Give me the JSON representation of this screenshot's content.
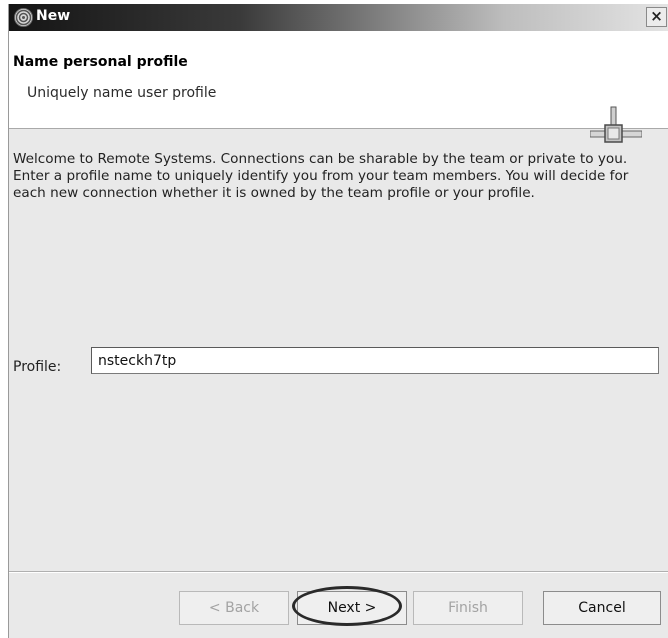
{
  "window": {
    "title": "New",
    "close_label": "×"
  },
  "header": {
    "title": "Name personal profile",
    "subtitle": "Uniquely name user profile"
  },
  "body": {
    "description": "Welcome to Remote Systems. Connections can be sharable by the team or private to you. Enter a profile name to uniquely identify you from your team members. You will decide for each new connection whether it is owned by the team profile or your profile."
  },
  "profile": {
    "label": "Profile:",
    "value": "nsteckh7tp"
  },
  "buttons": {
    "back": "< Back",
    "next": "Next >",
    "finish": "Finish",
    "cancel": "Cancel"
  },
  "state": {
    "back_enabled": false,
    "next_enabled": true,
    "finish_enabled": false,
    "cancel_enabled": true,
    "next_circled": true
  },
  "icons": {
    "app": "eclipse-icon",
    "wizard": "connection-graphic-icon"
  }
}
